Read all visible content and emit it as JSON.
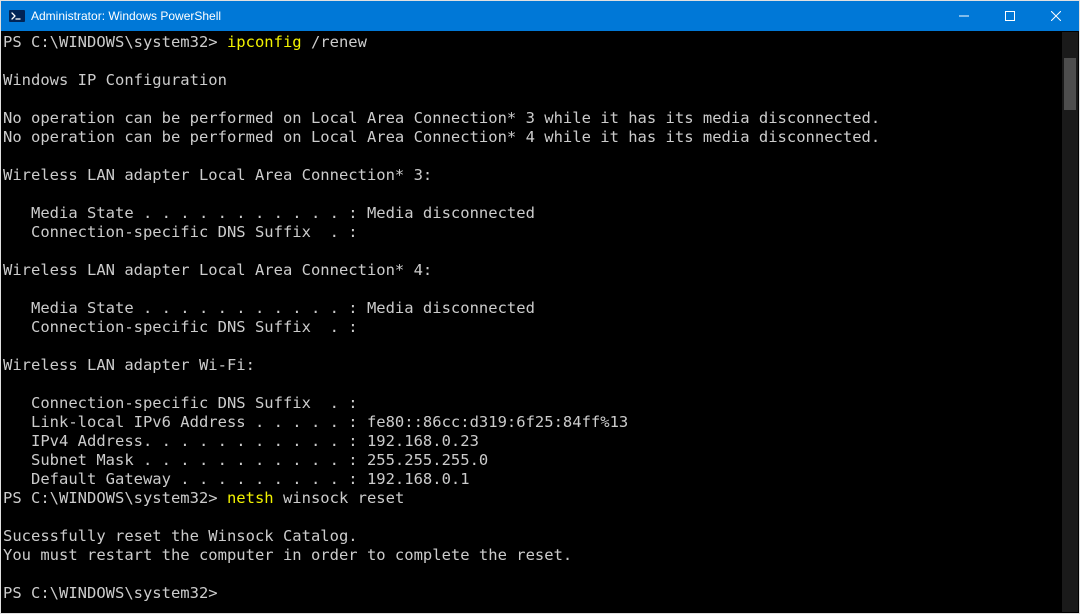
{
  "titlebar": {
    "title": "Administrator: Windows PowerShell"
  },
  "terminal": {
    "prompt1": "PS C:\\WINDOWS\\system32> ",
    "cmd1a": "ipconfig ",
    "cmd1b": "/renew",
    "blank1": "",
    "line_ipconfig_header": "Windows IP Configuration",
    "blank2": "",
    "line_noop3": "No operation can be performed on Local Area Connection* 3 while it has its media disconnected.",
    "line_noop4": "No operation can be performed on Local Area Connection* 4 while it has its media disconnected.",
    "blank3": "",
    "line_wlan3_header": "Wireless LAN adapter Local Area Connection* 3:",
    "blank4": "",
    "line_wlan3_media": "   Media State . . . . . . . . . . . : Media disconnected",
    "line_wlan3_suffix": "   Connection-specific DNS Suffix  . :",
    "blank5": "",
    "line_wlan4_header": "Wireless LAN adapter Local Area Connection* 4:",
    "blank6": "",
    "line_wlan4_media": "   Media State . . . . . . . . . . . : Media disconnected",
    "line_wlan4_suffix": "   Connection-specific DNS Suffix  . :",
    "blank7": "",
    "line_wifi_header": "Wireless LAN adapter Wi-Fi:",
    "blank8": "",
    "line_wifi_suffix": "   Connection-specific DNS Suffix  . :",
    "line_wifi_ipv6": "   Link-local IPv6 Address . . . . . : fe80::86cc:d319:6f25:84ff%13",
    "line_wifi_ipv4": "   IPv4 Address. . . . . . . . . . . : 192.168.0.23",
    "line_wifi_mask": "   Subnet Mask . . . . . . . . . . . : 255.255.255.0",
    "line_wifi_gw": "   Default Gateway . . . . . . . . . : 192.168.0.1",
    "prompt2": "PS C:\\WINDOWS\\system32> ",
    "cmd2a": "netsh ",
    "cmd2b": "winsock reset",
    "blank9": "",
    "line_reset1": "Sucessfully reset the Winsock Catalog.",
    "line_reset2": "You must restart the computer in order to complete the reset.",
    "blank10": "",
    "prompt3": "PS C:\\WINDOWS\\system32> "
  }
}
